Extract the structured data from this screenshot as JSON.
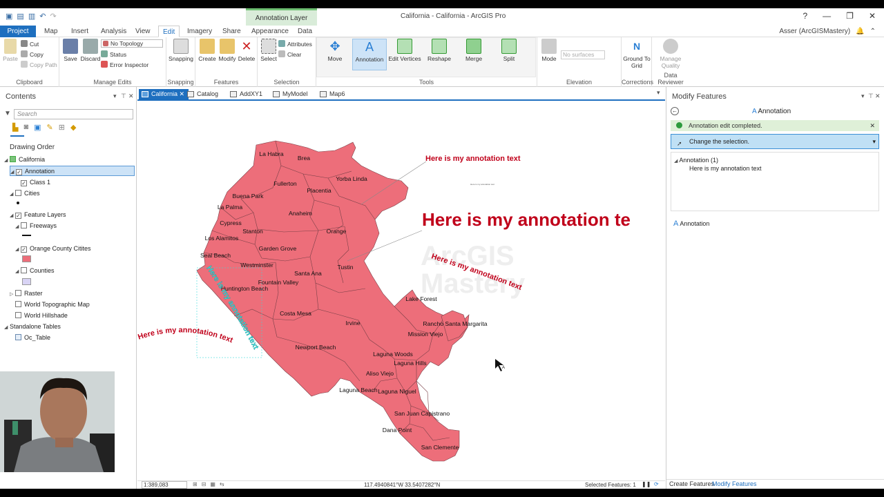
{
  "window": {
    "title": "California - California - ArcGIS Pro",
    "context_tab_group": "Annotation Layer",
    "user": "Asser (ArcGISMastery)"
  },
  "window_controls": {
    "help": "?",
    "min": "—",
    "max": "❐",
    "close": "✕"
  },
  "qat_icons": [
    "new-icon",
    "open-icon",
    "save-icon",
    "undo-icon",
    "redo-icon"
  ],
  "tabs": [
    {
      "label": "Project"
    },
    {
      "label": "Map"
    },
    {
      "label": "Insert"
    },
    {
      "label": "Analysis"
    },
    {
      "label": "View"
    },
    {
      "label": "Edit"
    },
    {
      "label": "Imagery"
    },
    {
      "label": "Share"
    },
    {
      "label": "Appearance"
    },
    {
      "label": "Data"
    }
  ],
  "ribbon": {
    "clipboard": {
      "label": "Clipboard",
      "paste": "Paste",
      "cut": "Cut",
      "copy": "Copy",
      "copy_path": "Copy Path"
    },
    "manage_edits": {
      "label": "Manage Edits",
      "save": "Save",
      "discard": "Discard",
      "topology": "No Topology",
      "status": "Status",
      "error_inspector": "Error Inspector"
    },
    "snapping": {
      "label": "Snapping",
      "button": "Snapping"
    },
    "features": {
      "label": "Features",
      "create": "Create",
      "modify": "Modify",
      "delete": "Delete"
    },
    "selection": {
      "label": "Selection",
      "select": "Select",
      "attributes": "Attributes",
      "clear": "Clear"
    },
    "tools": {
      "label": "Tools",
      "move": "Move",
      "annotation": "Annotation",
      "edit_vertices": "Edit Vertices",
      "reshape": "Reshape",
      "merge": "Merge",
      "split": "Split"
    },
    "elevation": {
      "label": "Elevation",
      "mode": "Mode",
      "surfaces": "No surfaces"
    },
    "corrections": {
      "label": "Corrections",
      "ground_to_grid": "Ground To Grid"
    },
    "data_reviewer": {
      "label": "Data Reviewer",
      "manage_quality": "Manage Quality"
    }
  },
  "contents": {
    "title": "Contents",
    "search_placeholder": "Search",
    "drawing_order": "Drawing Order",
    "items": [
      "California",
      "Annotation",
      "Class 1",
      "Cities",
      "Feature Layers",
      "Freeways",
      "Orange County Citites",
      "Counties",
      "Raster",
      "World Topographic Map",
      "World Hillshade",
      "Standalone Tables",
      "Oc_Table"
    ]
  },
  "map_tabs": [
    "California",
    "Catalog",
    "AddXY1",
    "MyModel",
    "Map6"
  ],
  "map": {
    "cities": [
      "La Habra",
      "Brea",
      "Fullerton",
      "Yorba Linda",
      "Placentia",
      "Buena Park",
      "La Palma",
      "Anaheim",
      "Cypress",
      "Stanton",
      "Orange",
      "Los Alamitos",
      "Garden Grove",
      "Seal Beach",
      "Westminster",
      "Santa Ana",
      "Tustin",
      "Huntington Beach",
      "Fountain Valley",
      "Costa Mesa",
      "Irvine",
      "Newport Beach",
      "Lake Forest",
      "Rancho Santa Margarita",
      "Mission Viejo",
      "Laguna Woods",
      "Laguna Hills",
      "Aliso Viejo",
      "Laguna Beach",
      "Laguna Niguel",
      "San Juan Capistrano",
      "Dana Point",
      "San Clemente"
    ],
    "annotation_small": "Here is my annotation text",
    "annotation_large": "Here is my annotation te",
    "annotation_curved_1": "Here is my annotation text",
    "annotation_curved_2": "Here is my annotation text",
    "annotation_cyan": "Here is my annotation text",
    "annotation_tiny": "Here is my annotation text",
    "watermark": [
      "ArcGIS",
      "Mastery"
    ],
    "scale": "1:389,083",
    "coords": "117.4940841°W 33.5407282°N",
    "selected_features": "Selected Features: 1"
  },
  "modify": {
    "title": "Modify Features",
    "tool": "Annotation",
    "message": "Annotation edit completed.",
    "change_selection": "Change the selection.",
    "tree_parent": "Annotation (1)",
    "tree_child": "Here is my annotation text",
    "layer": "Annotation",
    "tab_create": "Create Features",
    "tab_modify": "Modify Features"
  },
  "colors": {
    "accent": "#1e6fbf",
    "polygon_fill": "#ed6e7a",
    "annotation_red": "#c0001a",
    "annotation_cyan": "#3ad8d8"
  }
}
